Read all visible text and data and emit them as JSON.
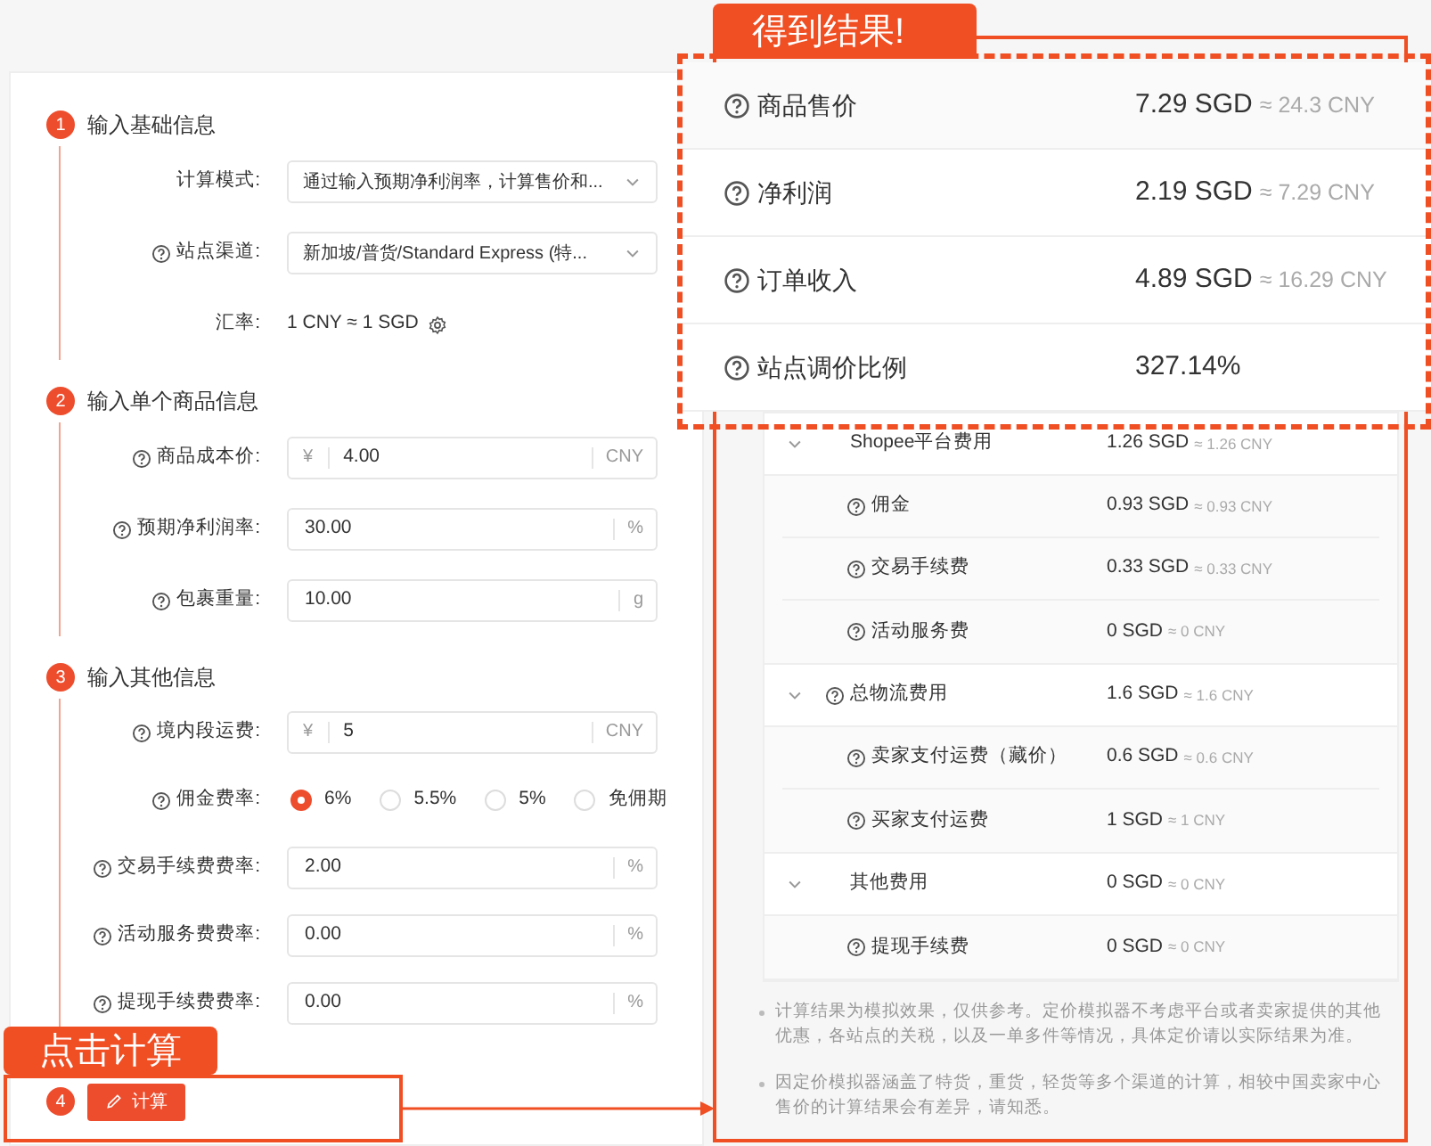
{
  "steps": [
    {
      "number": "1",
      "title": "输入基础信息",
      "fields": [
        {
          "kind": "select",
          "label": "计算模式:",
          "help": false,
          "value": "通过输入预期净利润率，计算售价和..."
        },
        {
          "kind": "select",
          "label": "站点渠道:",
          "help": true,
          "value": "新加坡/普货/Standard Express (特..."
        },
        {
          "kind": "text",
          "label": "汇率:",
          "help": false,
          "value": "1 CNY ≈ 1 SGD"
        }
      ]
    },
    {
      "number": "2",
      "title": "输入单个商品信息",
      "fields": [
        {
          "kind": "input",
          "label": "商品成本价:",
          "help": true,
          "prefix": "¥",
          "value": "4.00",
          "suffix": "CNY"
        },
        {
          "kind": "input",
          "label": "预期净利润率:",
          "help": true,
          "value": "30.00",
          "suffix": "%"
        },
        {
          "kind": "input",
          "label": "包裹重量:",
          "help": true,
          "value": "10.00",
          "suffix": "g"
        }
      ]
    },
    {
      "number": "3",
      "title": "输入其他信息",
      "fields": [
        {
          "kind": "input",
          "label": "境内段运费:",
          "help": true,
          "prefix": "¥",
          "value": "5",
          "suffix": "CNY"
        },
        {
          "kind": "radio",
          "label": "佣金费率:",
          "help": true,
          "options": [
            {
              "label": "6%",
              "selected": true
            },
            {
              "label": "5.5%",
              "selected": false
            },
            {
              "label": "5%",
              "selected": false
            },
            {
              "label": "免佣期",
              "selected": false
            }
          ]
        },
        {
          "kind": "input",
          "label": "交易手续费费率:",
          "help": true,
          "value": "2.00",
          "suffix": "%"
        },
        {
          "kind": "input",
          "label": "活动服务费费率:",
          "help": true,
          "value": "0.00",
          "suffix": "%"
        },
        {
          "kind": "input",
          "label": "提现手续费费率:",
          "help": true,
          "value": "0.00",
          "suffix": "%"
        }
      ]
    }
  ],
  "calculate": {
    "number": "4",
    "label": "计算"
  },
  "results": [
    {
      "label": "商品售价",
      "value": "7.29 SGD",
      "converted": "≈ 24.3 CNY"
    },
    {
      "label": "净利润",
      "value": "2.19 SGD",
      "converted": "≈ 7.29 CNY"
    },
    {
      "label": "订单收入",
      "value": "4.89 SGD",
      "converted": "≈ 16.29 CNY"
    },
    {
      "label": "站点调价比例",
      "value": "327.14%"
    }
  ],
  "breakdown": [
    {
      "label": "Shopee平台费用",
      "help": false,
      "expanded": true,
      "value": "1.26 SGD",
      "converted": "≈ 1.26 CNY",
      "children": [
        {
          "label": "佣金",
          "help": true,
          "value": "0.93 SGD",
          "converted": "≈ 0.93 CNY"
        },
        {
          "label": "交易手续费",
          "help": true,
          "value": "0.33 SGD",
          "converted": "≈ 0.33 CNY"
        },
        {
          "label": "活动服务费",
          "help": true,
          "value": "0 SGD",
          "converted": "≈ 0 CNY"
        }
      ]
    },
    {
      "label": "总物流费用",
      "help": true,
      "expanded": true,
      "value": "1.6 SGD",
      "converted": "≈ 1.6 CNY",
      "children": [
        {
          "label": "卖家支付运费（藏价）",
          "help": true,
          "value": "0.6 SGD",
          "converted": "≈ 0.6 CNY"
        },
        {
          "label": "买家支付运费",
          "help": true,
          "value": "1 SGD",
          "converted": "≈ 1 CNY"
        }
      ]
    },
    {
      "label": "其他费用",
      "help": false,
      "expanded": true,
      "value": "0 SGD",
      "converted": "≈ 0 CNY",
      "children": [
        {
          "label": "提现手续费",
          "help": true,
          "value": "0 SGD",
          "converted": "≈ 0 CNY"
        }
      ]
    }
  ],
  "notes": [
    "计算结果为模拟效果，仅供参考。定价模拟器不考虑平台或者卖家提供的其他优惠，各站点的关税，以及一单多件等情况，具体定价请以实际结果为准。",
    "因定价模拟器涵盖了特货，重货，轻货等多个渠道的计算，相较中国卖家中心售价的计算结果会有差异，请知悉。"
  ],
  "annotations": {
    "result_callout": "得到结果!",
    "calculate_callout": "点击计算"
  }
}
